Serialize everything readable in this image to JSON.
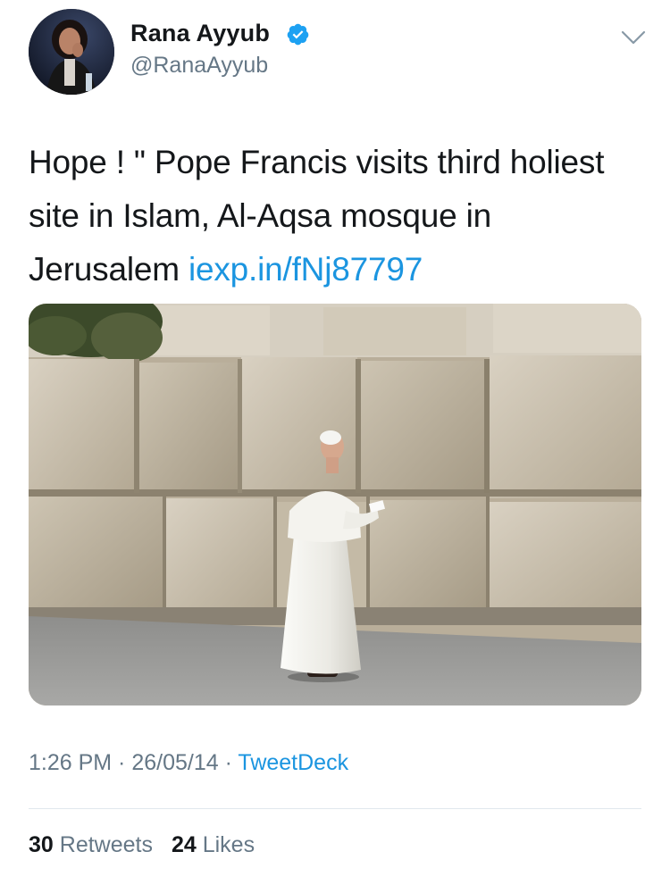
{
  "author": {
    "display_name": "Rana Ayyub",
    "handle": "@RanaAyyub",
    "verified_icon": "verified-badge-icon",
    "avatar_icon": "avatar-photo"
  },
  "tweet": {
    "text": "Hope ! \" Pope Francis visits third holiest site in Islam, Al-Aqsa mosque in Jerusalem ",
    "link": "iexp.in/fNj87797",
    "media_icon": "photo-pope-at-stone-wall"
  },
  "meta": {
    "time": "1:26 PM",
    "sep1": " · ",
    "date": "26/05/14",
    "sep2": " · ",
    "source": "TweetDeck"
  },
  "stats": {
    "retweets_count": "30",
    "retweets_label": "Retweets",
    "likes_count": "24",
    "likes_label": "Likes"
  },
  "colors": {
    "link": "#1b95e0",
    "secondary_text": "#657786",
    "primary_text": "#14171a",
    "divider": "#e1e8ed"
  }
}
